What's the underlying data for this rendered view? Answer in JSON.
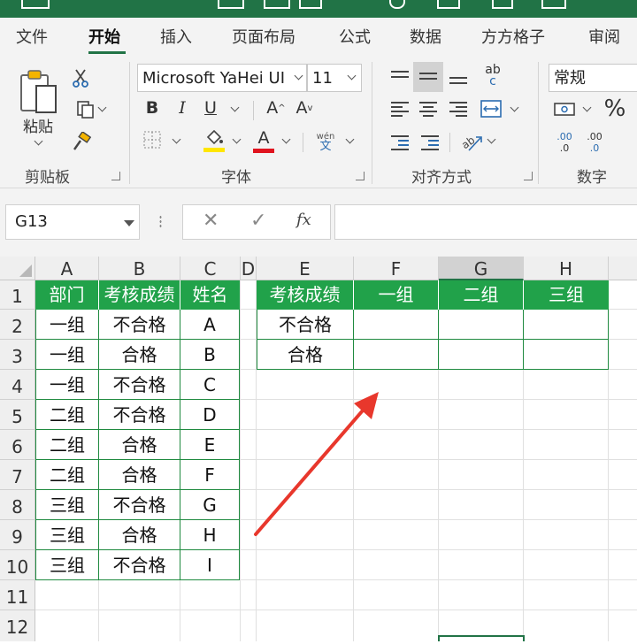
{
  "ribbon_tabs": [
    "文件",
    "开始",
    "插入",
    "页面布局",
    "公式",
    "数据",
    "方方格子",
    "审阅"
  ],
  "active_tab": "开始",
  "clipboard": {
    "paste_label": "粘贴",
    "group_label": "剪贴板"
  },
  "font": {
    "name": "Microsoft YaHei UI",
    "size": "11",
    "group_label": "字体",
    "bold": "B",
    "italic": "I",
    "underline": "U",
    "grow": "A",
    "shrink": "A",
    "font_color_letter": "A",
    "phonetic_top": "wén",
    "phonetic_bottom": "文"
  },
  "alignment": {
    "group_label": "对齐方式",
    "wrap_top": "ab",
    "wrap_bottom": "c"
  },
  "number": {
    "format": "常规",
    "group_label": "数字",
    "percent": "%",
    "inc_decimal": ".00",
    "dec_decimal": ".00"
  },
  "formula_bar": {
    "name_box": "G13",
    "fx_label": "fx",
    "formula": ""
  },
  "colors": {
    "accent": "#217346",
    "header_fill": "#21a24a",
    "arrow": "#e8372c",
    "selection": "#217346"
  },
  "columns": [
    "A",
    "B",
    "C",
    "D",
    "E",
    "F",
    "G",
    "H"
  ],
  "selected_column": "G",
  "rows": [
    "1",
    "2",
    "3",
    "4",
    "5",
    "6",
    "7",
    "8",
    "9",
    "10",
    "11",
    "12"
  ],
  "table_left": {
    "headers": [
      "部门",
      "考核成绩",
      "姓名"
    ],
    "rows": [
      [
        "一组",
        "不合格",
        "A"
      ],
      [
        "一组",
        "合格",
        "B"
      ],
      [
        "一组",
        "不合格",
        "C"
      ],
      [
        "二组",
        "不合格",
        "D"
      ],
      [
        "二组",
        "合格",
        "E"
      ],
      [
        "二组",
        "合格",
        "F"
      ],
      [
        "三组",
        "不合格",
        "G"
      ],
      [
        "三组",
        "合格",
        "H"
      ],
      [
        "三组",
        "不合格",
        "I"
      ]
    ]
  },
  "table_right": {
    "headers": [
      "考核成绩",
      "一组",
      "二组",
      "三组"
    ],
    "rows": [
      [
        "不合格",
        "",
        "",
        ""
      ],
      [
        "合格",
        "",
        "",
        ""
      ]
    ]
  }
}
